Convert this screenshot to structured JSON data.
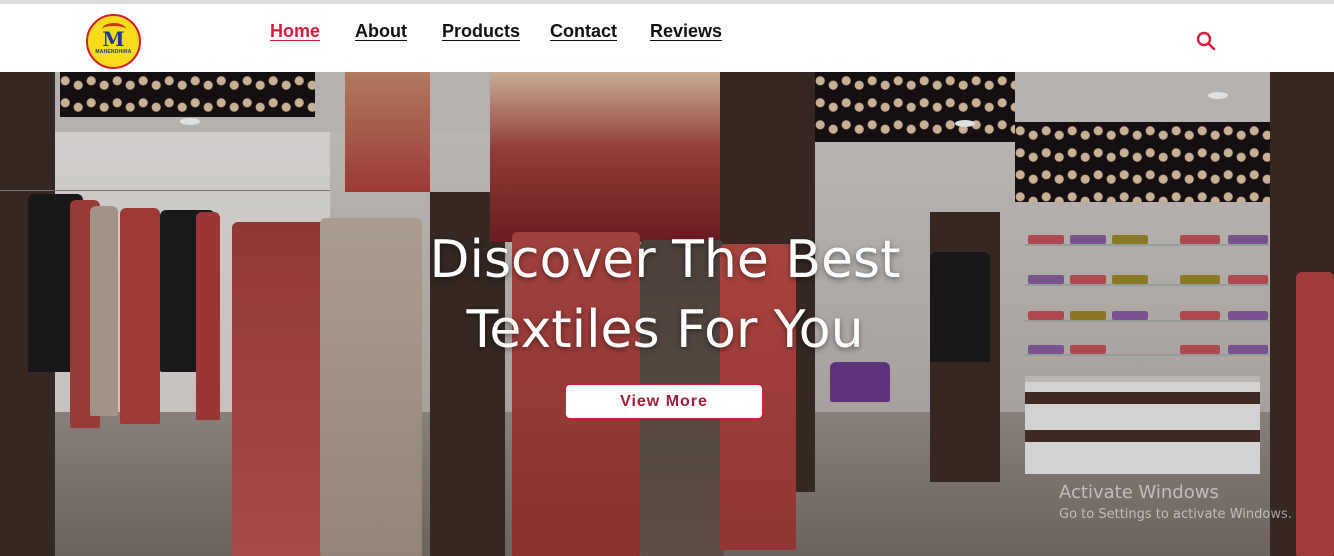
{
  "brand": {
    "logo_text": "MAHENDHIRA",
    "logo_letter": "M"
  },
  "nav": {
    "items": [
      {
        "label": "Home",
        "active": true
      },
      {
        "label": "About",
        "active": false
      },
      {
        "label": "Products",
        "active": false
      },
      {
        "label": "Contact",
        "active": false
      },
      {
        "label": "Reviews",
        "active": false
      }
    ],
    "search_icon": "search-icon"
  },
  "hero": {
    "line1": "Discover The Best",
    "line2": "Textiles For You",
    "button_label": "View More"
  },
  "watermark": {
    "title": "Activate Windows",
    "subtitle": "Go to Settings to activate Windows."
  },
  "colors": {
    "accent": "#d81a3c",
    "nav_text": "#111111",
    "logo_yellow": "#f7dc1e"
  }
}
